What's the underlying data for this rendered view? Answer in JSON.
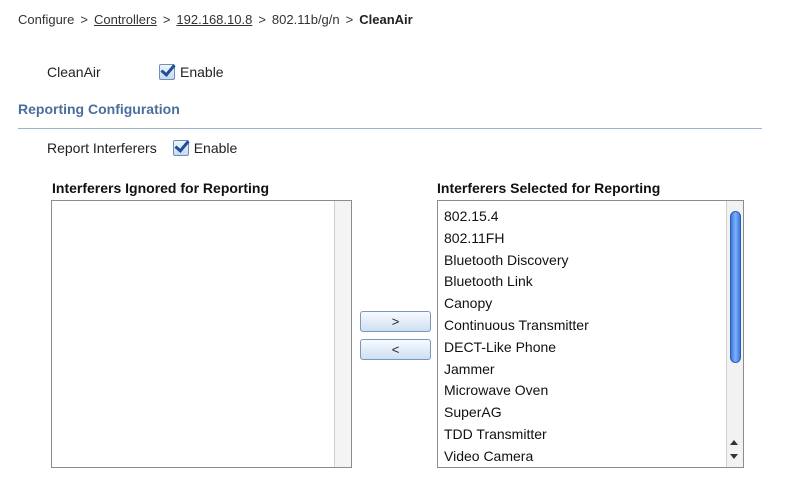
{
  "breadcrumb": {
    "items": [
      "Configure",
      "Controllers",
      "192.168.10.8",
      "802.11b/g/n",
      "CleanAir"
    ],
    "separator": ">"
  },
  "cleanair": {
    "label": "CleanAir",
    "checkbox_label": "Enable",
    "checked": true
  },
  "reporting": {
    "section_title": "Reporting Configuration",
    "report_interferers_label": "Report Interferers",
    "checkbox_label": "Enable",
    "checked": true
  },
  "lists": {
    "ignored_header": "Interferers Ignored for Reporting",
    "selected_header": "Interferers Selected for Reporting",
    "ignored_items": [],
    "selected_items": [
      "802.15.4",
      "802.11FH",
      "Bluetooth Discovery",
      "Bluetooth Link",
      "Canopy",
      "Continuous Transmitter",
      "DECT-Like Phone",
      "Jammer",
      "Microwave Oven",
      "SuperAG",
      "TDD Transmitter",
      "Video Camera"
    ]
  },
  "buttons": {
    "add_label": ">",
    "remove_label": "<"
  },
  "colors": {
    "section_title": "#4a6f9c",
    "rule": "#9ab3cf",
    "scroll_thumb": "#3c78d8"
  }
}
